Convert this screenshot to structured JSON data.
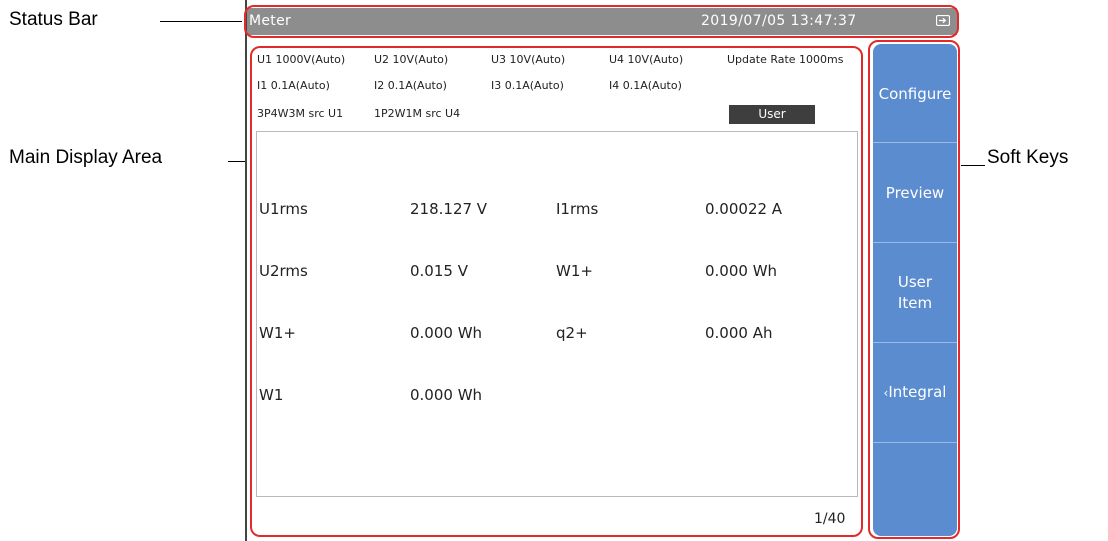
{
  "annotations": {
    "status_bar": "Status Bar",
    "main_display_area": "Main Display Area",
    "soft_keys": "Soft Keys"
  },
  "status_bar": {
    "title": "Meter",
    "datetime": "2019/07/05 13:47:37",
    "icon": "input-plug-icon"
  },
  "ranges": {
    "row1": [
      "U1 1000V(Auto)",
      "U2 10V(Auto)",
      "U3 10V(Auto)",
      "U4 10V(Auto)",
      "Update Rate 1000ms"
    ],
    "row2": [
      "I1 0.1A(Auto)",
      "I2 0.1A(Auto)",
      "I3 0.1A(Auto)",
      "I4 0.1A(Auto)"
    ],
    "row3": [
      "3P4W3M src U1",
      "1P2W1M src U4"
    ],
    "mode": "User"
  },
  "measurements": [
    {
      "left_name": "U1rms",
      "left_value": "218.127  V",
      "right_name": "I1rms",
      "right_value": "0.00022  A"
    },
    {
      "left_name": "U2rms",
      "left_value": "0.015  V",
      "right_name": "W1+",
      "right_value": "0.000  Wh"
    },
    {
      "left_name": "W1+",
      "left_value": "0.000  Wh",
      "right_name": "q2+",
      "right_value": "0.000  Ah"
    },
    {
      "left_name": "W1",
      "left_value": "0.000  Wh",
      "right_name": "",
      "right_value": ""
    }
  ],
  "page_indicator": "1/40",
  "soft_keys": {
    "configure": "Configure",
    "preview": "Preview",
    "user_item_line1": "User",
    "user_item_line2": "Item",
    "integral": "Integral",
    "integral_prefix": "‹"
  },
  "colors": {
    "highlight": "#e32a2a",
    "softkey_bg": "#5a8ccf",
    "status_bg": "#8d8d8d"
  }
}
